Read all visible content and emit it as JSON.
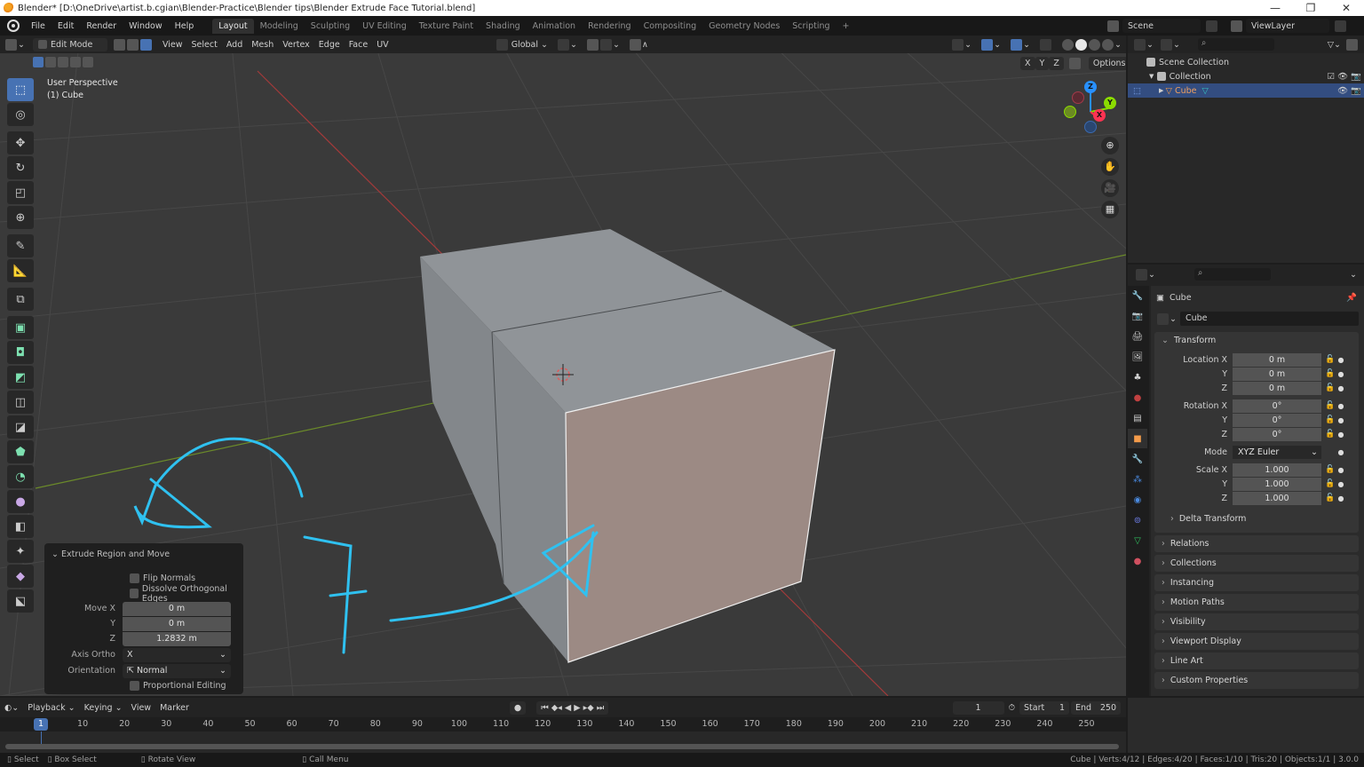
{
  "window": {
    "title": "Blender* [D:\\OneDrive\\artist.b.cgian\\Blender-Practice\\Blender tips\\Blender Extrude Face Tutorial.blend]",
    "minimize": "—",
    "maximize": "❐",
    "close": "✕"
  },
  "menubar": {
    "menus": [
      "File",
      "Edit",
      "Render",
      "Window",
      "Help"
    ],
    "workspaces": [
      "Layout",
      "Modeling",
      "Sculpting",
      "UV Editing",
      "Texture Paint",
      "Shading",
      "Animation",
      "Rendering",
      "Compositing",
      "Geometry Nodes",
      "Scripting"
    ],
    "active_workspace": "Layout",
    "add_workspace": "+",
    "scene": "Scene",
    "view_layer": "ViewLayer"
  },
  "viewport_header": {
    "mode": "Edit Mode",
    "menus": [
      "View",
      "Select",
      "Add",
      "Mesh",
      "Vertex",
      "Edge",
      "Face",
      "UV"
    ],
    "orientation": "Global",
    "mirror_axes": [
      "X",
      "Y",
      "Z"
    ],
    "options": "Options"
  },
  "viewport": {
    "view_name": "User Perspective",
    "object_label": "(1) Cube",
    "gizmo": {
      "z": "Z",
      "y": "Y",
      "x": "X"
    },
    "colors": {
      "x_axis": "#ff3352",
      "y_axis": "#8bdc00",
      "z_axis": "#2890ff",
      "annotation": "#2fc1f0",
      "selected_face": "#9c8a84",
      "cube": "#8c9094"
    },
    "annotation_text": "7"
  },
  "tools": [
    "select-box",
    "cursor",
    "move",
    "rotate",
    "scale",
    "transform",
    "annotate",
    "measure",
    "add-cube",
    "extrude-region",
    "inset-faces",
    "bevel",
    "loop-cut",
    "knife",
    "poly-build",
    "spin",
    "smooth",
    "edge-slide",
    "shrink-fatten",
    "shear",
    "rip-region"
  ],
  "redo_panel": {
    "title": "Extrude Region and Move",
    "flip_normals": "Flip Normals",
    "dissolve_orthogonal": "Dissolve Orthogonal Edges",
    "move_x_label": "Move X",
    "move_y_label": "Y",
    "move_z_label": "Z",
    "move_x": "0 m",
    "move_y": "0 m",
    "move_z": "1.2832 m",
    "axis_ortho_label": "Axis Ortho",
    "axis_ortho": "X",
    "orientation_label": "Orientation",
    "orientation": "Normal",
    "proportional": "Proportional Editing"
  },
  "outliner": {
    "scene_collection": "Scene Collection",
    "collection": "Collection",
    "object": "Cube"
  },
  "properties": {
    "object_name": "Cube",
    "datablock": "Cube",
    "transform_title": "Transform",
    "location_label": "Location X",
    "rotation_label": "Rotation X",
    "scale_label": "Scale X",
    "y_label": "Y",
    "z_label": "Z",
    "location": [
      "0 m",
      "0 m",
      "0 m"
    ],
    "rotation": [
      "0°",
      "0°",
      "0°"
    ],
    "mode_label": "Mode",
    "mode": "XYZ Euler",
    "scale": [
      "1.000",
      "1.000",
      "1.000"
    ],
    "delta": "Delta Transform",
    "panels": [
      "Relations",
      "Collections",
      "Instancing",
      "Motion Paths",
      "Visibility",
      "Viewport Display",
      "Line Art",
      "Custom Properties"
    ]
  },
  "timeline": {
    "menus": [
      "Playback",
      "Keying",
      "View",
      "Marker"
    ],
    "current_frame": "1",
    "start_label": "Start",
    "start": "1",
    "end_label": "End",
    "end": "250",
    "ticks": [
      "10",
      "20",
      "30",
      "40",
      "50",
      "60",
      "70",
      "80",
      "90",
      "100",
      "110",
      "120",
      "130",
      "140",
      "150",
      "160",
      "170",
      "180",
      "190",
      "200",
      "210",
      "220",
      "230",
      "240",
      "250"
    ]
  },
  "statusbar": {
    "select": "Select",
    "box_select": "Box Select",
    "rotate_view": "Rotate View",
    "call_menu": "Call Menu",
    "stats": "Cube | Verts:4/12 | Edges:4/20 | Faces:1/10 | Tris:20 | Objects:1/1 | 3.0.0"
  }
}
